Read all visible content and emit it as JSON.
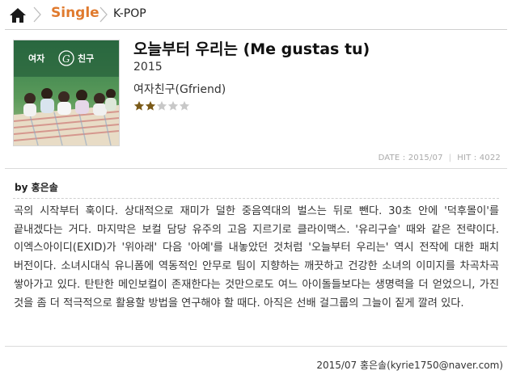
{
  "breadcrumb": {
    "home_icon": "home-icon",
    "section": "Single",
    "category": "K-POP",
    "section_color": "#e07a2e"
  },
  "album": {
    "cover_text": "여자친구",
    "title": "오늘부터 우리는 (Me gustas tu)",
    "year": "2015",
    "artist": "여자친구(Gfriend)",
    "rating": {
      "filled": 2,
      "max": 5,
      "filled_color": "#7a5a18",
      "empty_color": "#c8c8c8"
    }
  },
  "meta": {
    "date": "DATE : 2015/07",
    "hit": "HIT : 4022"
  },
  "review": {
    "byline_prefix": "by",
    "author": "홍은솔",
    "text": "곡의 시작부터 훅이다. 상대적으로 재미가 덜한 중음역대의 벌스는 뒤로 뺀다. 30초 안에 '덕후몰이'를 끝내겠다는 거다. 마지막은 보컬 담당 유주의 고음 지르기로 클라이맥스. '유리구슬' 때와 같은 전략이다. 이엑스아이디(EXID)가 '위아래' 다음 '아예'를 내놓았던 것처럼 '오늘부터 우리는' 역시 전작에 대한 패치 버전이다. 소녀시대식 유니폼에 역동적인 안무로 팀이 지향하는 깨끗하고 건강한 소녀의 이미지를 차곡차곡 쌓아가고 있다. 탄탄한 메인보컬이 존재한다는 것만으로도 여느 아이돌들보다는 생명력을 더 얻었으니, 가진 것을 좀 더 적극적으로 활용할 방법을 연구해야 할 때다. 아직은 선배 걸그룹의 그늘이 짙게 깔려 있다.",
    "signature": "2015/07 홍은솔(kyrie1750@naver.com)"
  }
}
